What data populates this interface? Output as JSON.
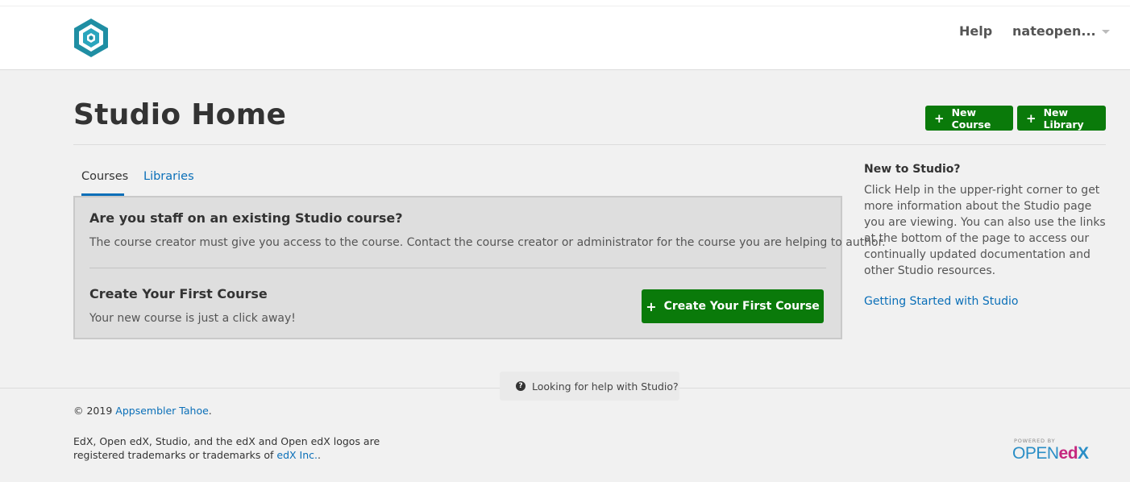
{
  "header": {
    "help_label": "Help",
    "user_label": "nateopen..."
  },
  "page": {
    "title": "Studio Home",
    "new_course_label": "New Course",
    "new_library_label": "New Library"
  },
  "tabs": [
    {
      "label": "Courses",
      "active": true
    },
    {
      "label": "Libraries",
      "active": false
    }
  ],
  "panel": {
    "staff_heading": "Are you staff on an existing Studio course?",
    "staff_text": "The course creator must give you access to the course. Contact the course creator or administrator for the course you are helping to author.",
    "create_heading": "Create Your First Course",
    "create_text": "Your new course is just a click away!",
    "create_button_label": "Create Your First Course"
  },
  "sidebar": {
    "heading": "New to Studio?",
    "text": "Click Help in the upper-right corner to get more information about the Studio page you are viewing. You can also use the links at the bottom of the page to access our continually updated documentation and other Studio resources.",
    "link_label": "Getting Started with Studio"
  },
  "footer": {
    "help_pill_label": "Looking for help with Studio?",
    "copyright_prefix": "© 2019",
    "copyright_link": "Appsembler Tahoe",
    "copyright_suffix": ".",
    "legal_text": "EdX, Open edX, Studio, and the edX and Open edX logos are registered trademarks or trademarks of",
    "legal_link": "edX Inc.",
    "legal_suffix": ".",
    "powered_by": "POWERED BY",
    "logo_open": "OPEN",
    "logo_ed": "ed",
    "logo_x": "X"
  },
  "colors": {
    "primary_green": "#0a7a0a",
    "link_blue": "#0a6fb8",
    "logo_teal": "#1f8ea3"
  },
  "icons": {
    "logo": "hexagon-logo-icon",
    "plus": "plus-icon",
    "help": "question-circle-icon",
    "caret": "caret-down-icon"
  }
}
